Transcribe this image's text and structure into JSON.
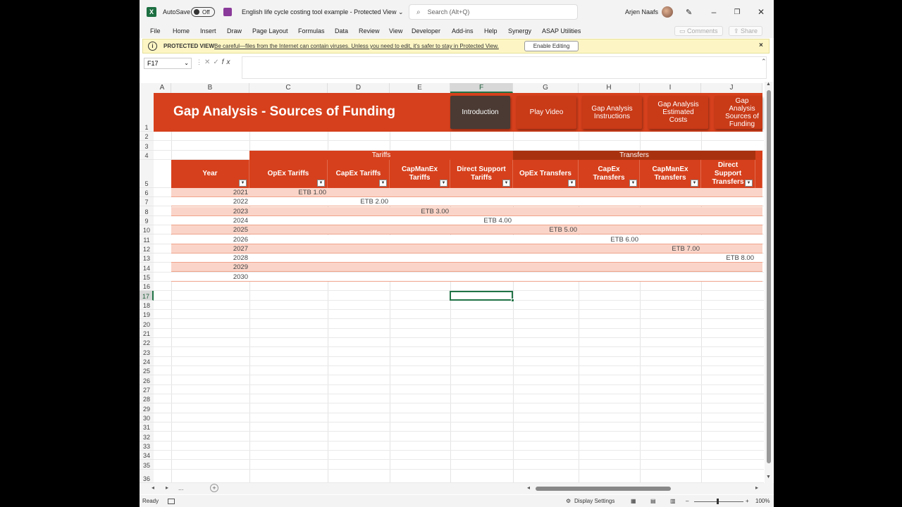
{
  "titlebar": {
    "app_icon": "X",
    "autosave_label": "AutoSave",
    "autosave_state": "Off",
    "doc_title": "English life cycle costing tool example  -  Protected View ⌄",
    "search_placeholder": "Search (Alt+Q)",
    "user_name": "Arjen Naafs"
  },
  "ribbon": {
    "tabs": [
      "File",
      "Home",
      "Insert",
      "Draw",
      "Page Layout",
      "Formulas",
      "Data",
      "Review",
      "View",
      "Developer",
      "Add-ins",
      "Help",
      "Synergy",
      "ASAP Utilities"
    ],
    "comments_label": "Comments",
    "share_label": "Share"
  },
  "protected": {
    "title": "PROTECTED VIEW",
    "message": "Be careful—files from the Internet can contain viruses. Unless you need to edit, it's safer to stay in Protected View.",
    "button": "Enable Editing",
    "close": "×"
  },
  "formula_bar": {
    "name_box": "F17",
    "fx": "fx",
    "value": ""
  },
  "columns": [
    "A",
    "B",
    "C",
    "D",
    "E",
    "F",
    "G",
    "H",
    "I",
    "J"
  ],
  "selected_column": "F",
  "rows": [
    "1",
    "2",
    "3",
    "4",
    "5",
    "6",
    "7",
    "8",
    "9",
    "10",
    "11",
    "12",
    "13",
    "14",
    "15",
    "16",
    "17",
    "18",
    "19",
    "20",
    "21",
    "22",
    "23",
    "24",
    "25",
    "26",
    "27",
    "28",
    "29",
    "30",
    "31",
    "32",
    "33",
    "34",
    "35",
    "36"
  ],
  "selected_row": "17",
  "banner": {
    "title": "Gap Analysis - Sources of Funding",
    "buttons": [
      "Introduction",
      "Play Video",
      "Gap Analysis Instructions",
      "Gap Analysis Estimated Costs",
      "Gap Analysis Sources of Funding"
    ]
  },
  "groups": {
    "tariffs": "Tariffs",
    "transfers": "Transfers"
  },
  "table": {
    "headers": [
      "Year",
      "OpEx Tariffs",
      "CapEx Tariffs",
      "CapManEx Tariffs",
      "Direct Support Tariffs",
      "OpEx Transfers",
      "CapEx Transfers",
      "CapManEx Transfers",
      "Direct Support Transfers"
    ],
    "header_color": "#d6401c",
    "stripe_color": "#fad4c8",
    "years": [
      "2021",
      "2022",
      "2023",
      "2024",
      "2025",
      "2026",
      "2027",
      "2028",
      "2029",
      "2030"
    ],
    "values": [
      "ETB 1.00",
      "ETB 2.00",
      "ETB 3.00",
      "ETB 4.00",
      "ETB 5.00",
      "ETB 6.00",
      "ETB 7.00",
      "ETB 8.00",
      "",
      ""
    ]
  },
  "sheetbar": {
    "more": "...",
    "add": "+"
  },
  "status": {
    "ready": "Ready",
    "display_settings": "Display Settings",
    "zoom": "100%"
  },
  "colors": {
    "accent": "#d6401c",
    "dark_button": "#4a3a33",
    "excel_green": "#217346"
  }
}
